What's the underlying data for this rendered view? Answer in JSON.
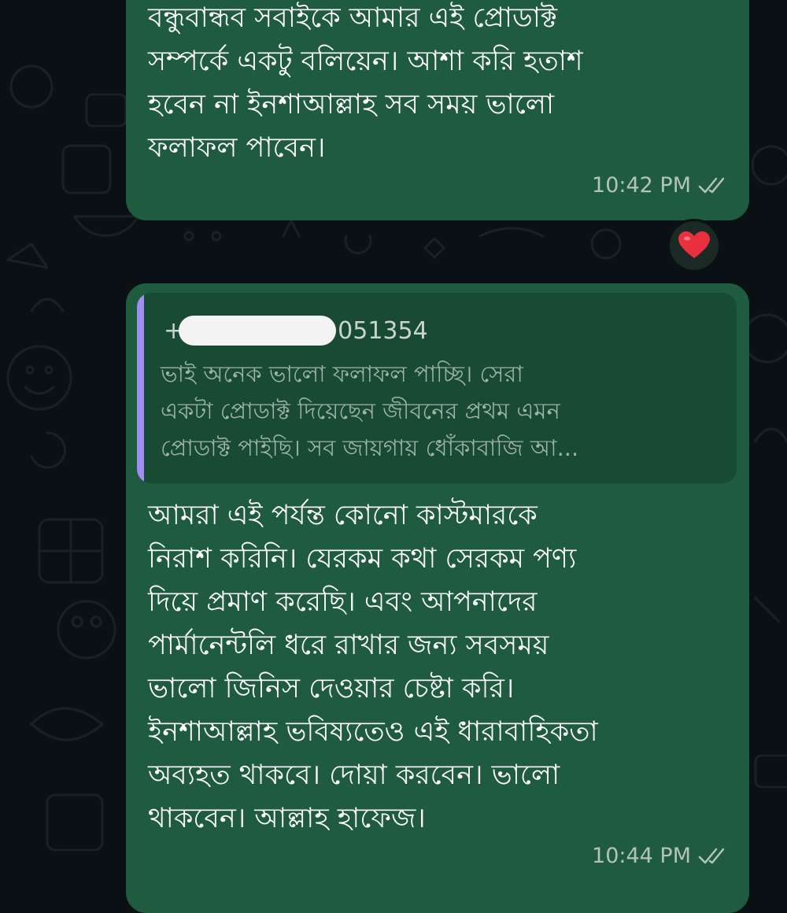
{
  "colors": {
    "background": "#0b1014",
    "outgoing_bubble": "#1f5b3f",
    "quote_background": "#184a34",
    "quote_accent": "#a38cf2",
    "timestamp": "#b2c4ba"
  },
  "messages": [
    {
      "text": "বন্ধুবান্ধব সবাইকে আমার এই প্রোডাক্ট\nসম্পর্কে একটু বলিয়েন। আশা করি হতাশ\nহবেন না ইনশাআল্লাহ সব সময় ভালো\nফলাফল পাবেন।",
      "time": "10:42 PM",
      "status_icon": "double-check-icon",
      "reaction": "❤️"
    },
    {
      "quoted": {
        "sender_prefix": "+",
        "sender_suffix": "051354",
        "text": "ভাই অনেক ভালো ফলাফল পাচ্ছি। সেরা\nএকটা প্রোডাক্ট দিয়েছেন জীবনের প্রথম এমন\nপ্রোডাক্ট পাইছি। সব জায়গায় ধোঁকাবাজি আ..."
      },
      "text": "আমরা এই পর্যন্ত কোনো কাস্টমারকে\nনিরাশ করিনি। যেরকম কথা সেরকম পণ্য\nদিয়ে প্রমাণ করেছি। এবং আপনাদের\nপার্মানেন্টলি ধরে রাখার জন্য সবসময়\nভালো জিনিস দেওয়ার চেষ্টা করি।\nইনশাআল্লাহ ভবিষ্যতেও এই ধারাবাহিকতা\nঅব্যহত থাকবে। দোয়া করবেন। ভালো\nথাকবেন। আল্লাহ হাফেজ।",
      "time": "10:44 PM",
      "status_icon": "double-check-icon"
    }
  ]
}
